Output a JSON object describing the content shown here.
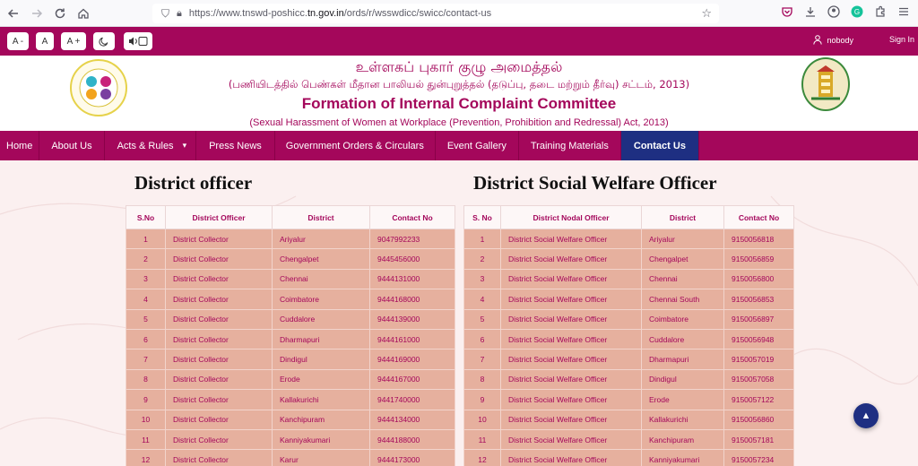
{
  "browser": {
    "url_prefix": "https://www.tnswd-poshicc.",
    "url_domain": "tn.gov.in",
    "url_path": "/ords/r/wsswdicc/swicc/contact-us"
  },
  "accessibility": {
    "font_decrease": "A -",
    "font_normal": "A",
    "font_increase": "A +",
    "username": "nobody",
    "sign_in": "Sign In"
  },
  "header": {
    "tamil_title": "உள்ளகப் புகார் குழு அமைத்தல்",
    "tamil_subtitle": "(பணியிடத்தில் பெண்கள் மீதான பாலியல் துன்புறுத்தல் (தடுப்பு, தடை மற்றும் தீர்வு) சட்டம், 2013)",
    "title": "Formation of Internal Complaint Committee",
    "subtitle": "(Sexual Harassment of Women at Workplace (Prevention, Prohibition and Redressal) Act, 2013)"
  },
  "nav": {
    "items": [
      "Home",
      "About Us",
      "Acts & Rules",
      "Press News",
      "Government Orders & Circulars",
      "Event Gallery",
      "Training Materials",
      "Contact Us"
    ],
    "active": "Contact Us"
  },
  "district_officer": {
    "title": "District officer",
    "headers": [
      "S.No",
      "District Officer",
      "District",
      "Contact No"
    ],
    "rows": [
      [
        "1",
        "District Collector",
        "Ariyalur",
        "9047992233"
      ],
      [
        "2",
        "District Collector",
        "Chengalpet",
        "9445456000"
      ],
      [
        "3",
        "District Collector",
        "Chennai",
        "9444131000"
      ],
      [
        "4",
        "District Collector",
        "Coimbatore",
        "9444168000"
      ],
      [
        "5",
        "District Collector",
        "Cuddalore",
        "9444139000"
      ],
      [
        "6",
        "District Collector",
        "Dharmapuri",
        "9444161000"
      ],
      [
        "7",
        "District Collector",
        "Dindigul",
        "9444169000"
      ],
      [
        "8",
        "District Collector",
        "Erode",
        "9444167000"
      ],
      [
        "9",
        "District Collector",
        "Kallakurichi",
        "9441740000"
      ],
      [
        "10",
        "District Collector",
        "Kanchipuram",
        "9444134000"
      ],
      [
        "11",
        "District Collector",
        "Kanniyakumari",
        "9444188000"
      ],
      [
        "12",
        "District Collector",
        "Karur",
        "9444173000"
      ]
    ]
  },
  "social_welfare": {
    "title": "District Social Welfare Officer",
    "headers": [
      "S. No",
      "District Nodal Officer",
      "District",
      "Contact No"
    ],
    "rows": [
      [
        "1",
        "District Social Welfare Officer",
        "Ariyalur",
        "9150056818"
      ],
      [
        "2",
        "District Social Welfare Officer",
        "Chengalpet",
        "9150056859"
      ],
      [
        "3",
        "District Social Welfare Officer",
        "Chennai",
        "9150056800"
      ],
      [
        "4",
        "District Social Welfare Officer",
        "Chennai South",
        "9150056853"
      ],
      [
        "5",
        "District Social Welfare Officer",
        "Coimbatore",
        "9150056897"
      ],
      [
        "6",
        "District Social Welfare Officer",
        "Cuddalore",
        "9150056948"
      ],
      [
        "7",
        "District Social Welfare Officer",
        "Dharmapuri",
        "9150057019"
      ],
      [
        "8",
        "District Social Welfare Officer",
        "Dindigul",
        "9150057058"
      ],
      [
        "9",
        "District Social Welfare Officer",
        "Erode",
        "9150057122"
      ],
      [
        "10",
        "District Social Welfare Officer",
        "Kallakurichi",
        "9150056860"
      ],
      [
        "11",
        "District Social Welfare Officer",
        "Kanchipuram",
        "9150057181"
      ],
      [
        "12",
        "District Social Welfare Officer",
        "Kanniyakumari",
        "9150057234"
      ]
    ]
  },
  "colors": {
    "brand": "#a4075b",
    "nav_active": "#1e2f82",
    "table_row": "#e6b09e"
  },
  "icons": {
    "back": "arrow-left-icon",
    "forward": "arrow-right-icon",
    "reload": "reload-icon",
    "home": "home-icon",
    "theme": "moon-icon",
    "audio": "speaker-icon",
    "user": "user-icon",
    "scroll_top": "chevron-up-icon"
  }
}
